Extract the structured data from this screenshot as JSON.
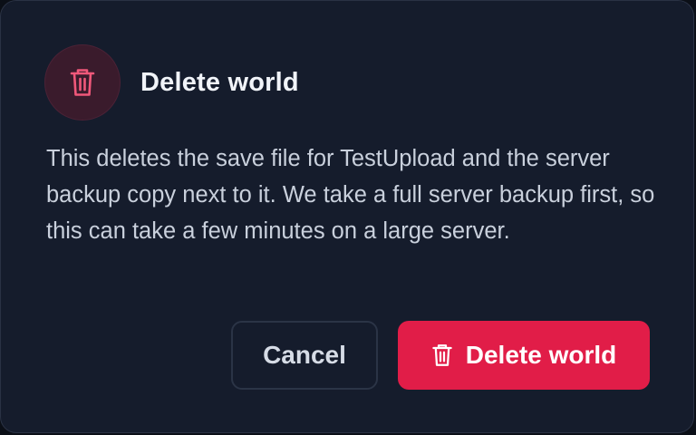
{
  "dialog": {
    "title": "Delete world",
    "icon": "trash-icon",
    "message": "This deletes the save file for TestUpload and the server backup copy next to it. We take a full server backup first, so this can take a few minutes on a large server."
  },
  "actions": {
    "cancel_label": "Cancel",
    "delete_label": "Delete world",
    "delete_icon": "trash-icon"
  },
  "colors": {
    "background": "#151c2c",
    "danger": "#e11d48",
    "icon_accent": "#f0587a",
    "icon_circle": "#3a1b2c"
  }
}
